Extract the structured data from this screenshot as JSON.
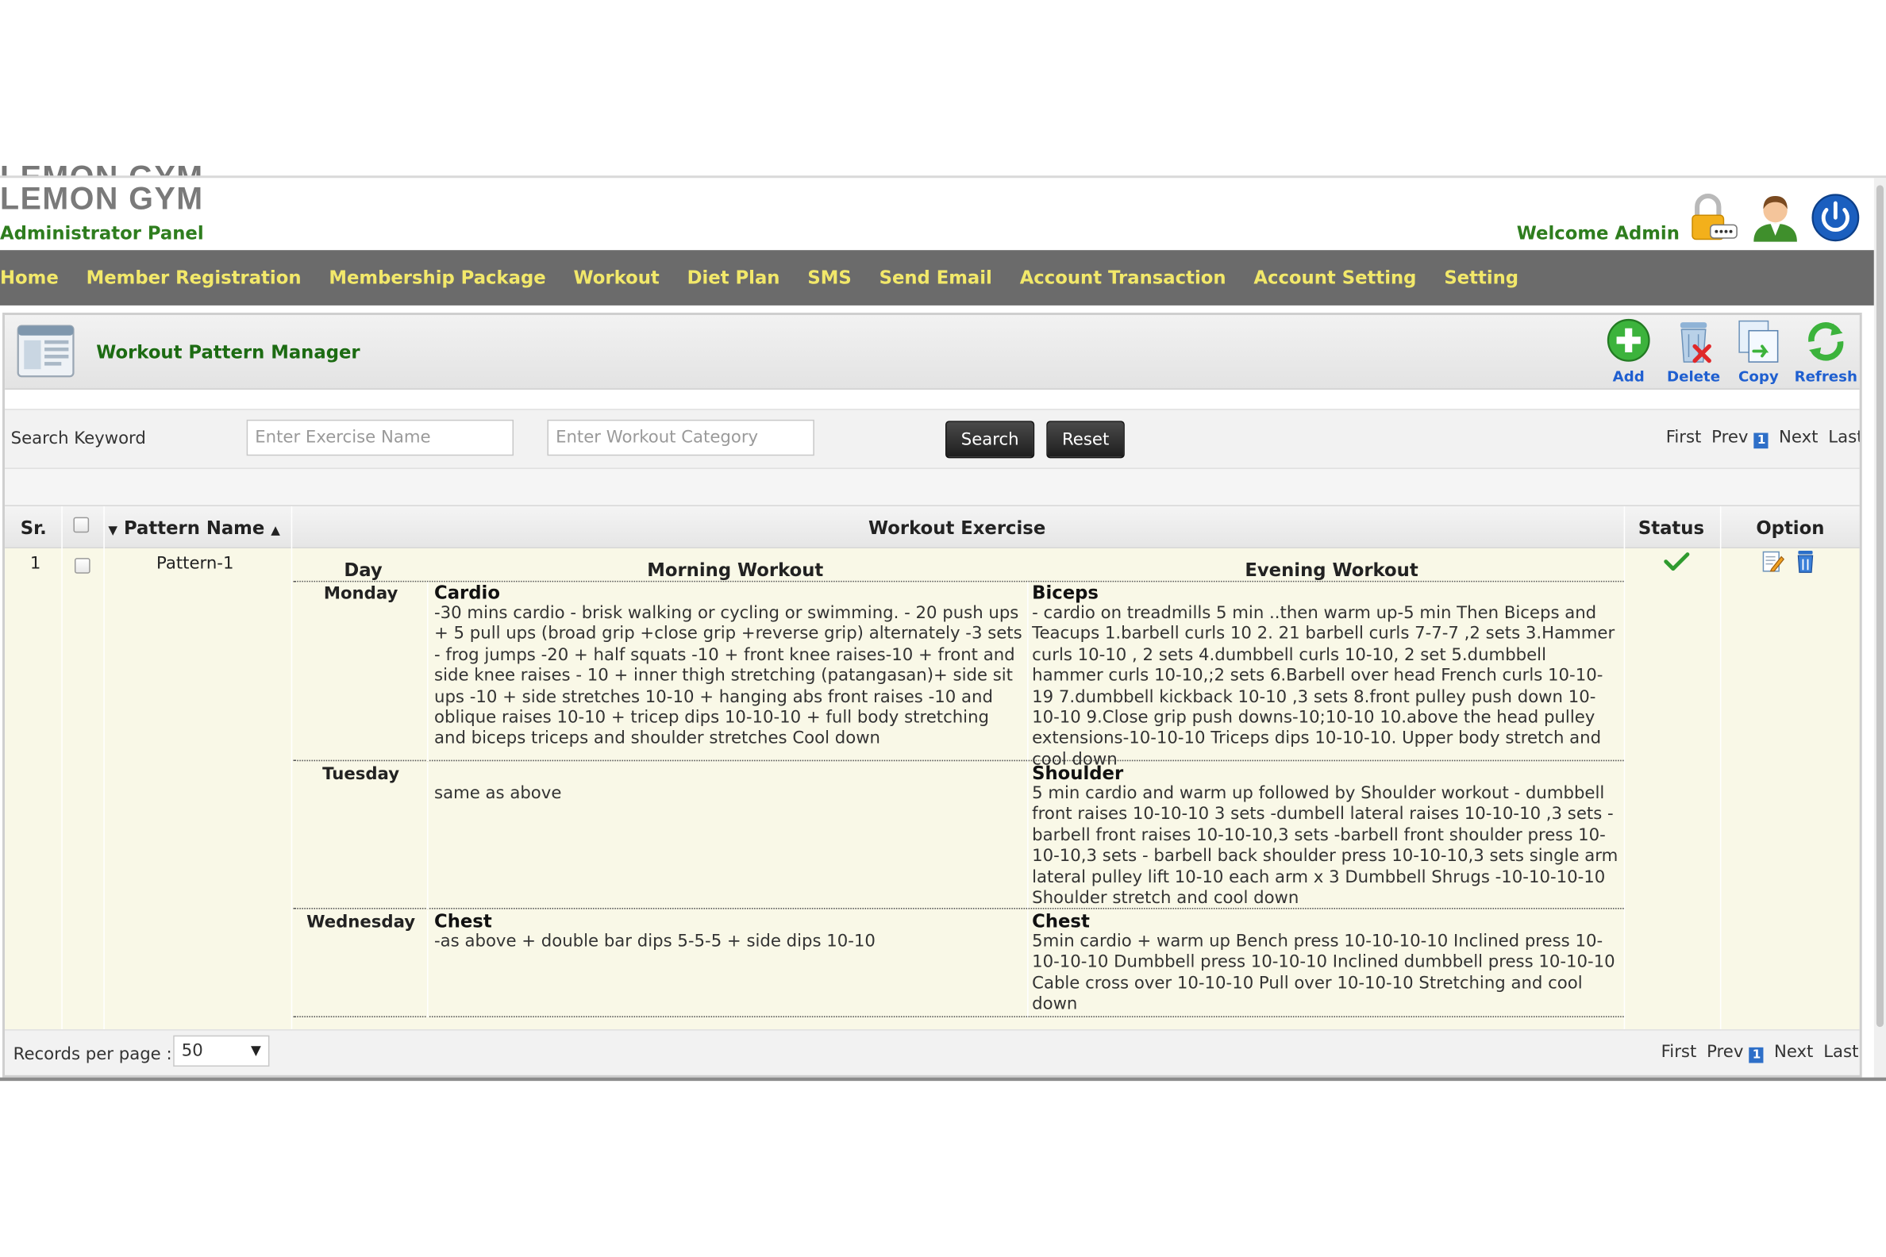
{
  "app": {
    "name": "LEMON GYM",
    "subtitle": "Administrator Panel",
    "welcome": "Welcome Admin",
    "colors": {
      "nav_bg": "#6b6b6b",
      "nav_text": "#f2e86a",
      "brand_green": "#2e7d1e",
      "link_blue": "#1f5fd0",
      "row_bg": "#f9f8e7"
    }
  },
  "header_icons": [
    "lock-icon",
    "admin-user-icon",
    "power-icon"
  ],
  "nav": {
    "items": [
      "Home",
      "Member Registration",
      "Membership Package",
      "Workout",
      "Diet Plan",
      "SMS",
      "Send Email",
      "Account Transaction",
      "Account Setting",
      "Setting"
    ]
  },
  "panel": {
    "title": "Workout Pattern Manager",
    "toolbar": {
      "add": "Add",
      "delete": "Delete",
      "copy": "Copy",
      "refresh": "Refresh"
    }
  },
  "search": {
    "label": "Search Keyword",
    "exercise_placeholder": "Enter Exercise Name",
    "exercise_value": "",
    "category_placeholder": "Enter Workout Category",
    "category_value": "",
    "search_button": "Search",
    "reset_button": "Reset"
  },
  "pager": {
    "first": "First",
    "prev": "Prev",
    "current": "1",
    "next": "Next",
    "last": "Last"
  },
  "table": {
    "headers": {
      "sr": "Sr.",
      "pattern_name": "Pattern Name",
      "workout_exercise": "Workout Exercise",
      "status": "Status",
      "option": "Option"
    },
    "sub_headers": {
      "day": "Day",
      "morning": "Morning Workout",
      "evening": "Evening Workout"
    },
    "rows": [
      {
        "sr": "1",
        "pattern_name": "Pattern-1",
        "status_icon": "check-icon",
        "days": [
          {
            "day": "Monday",
            "morning_title": "Cardio",
            "morning_text": "-30 mins cardio - brisk walking or cycling or swimming. - 20 push ups + 5 pull ups (broad grip +close grip +reverse grip) alternately -3 sets - frog jumps -20 + half squats -10 + front knee raises-10 + front and side knee raises - 10 + inner thigh stretching (patangasan)+ side sit ups -10 + side stretches 10-10 + hanging abs front raises -10 and oblique raises 10-10 + tricep dips 10-10-10 + full body stretching and biceps triceps and shoulder stretches Cool down",
            "evening_title": "Biceps",
            "evening_text": "- cardio on treadmills 5 min ..then warm up-5 min Then Biceps and Teacups 1.barbell curls 10 2. 21 barbell curls 7-7-7 ,2 sets 3.Hammer curls 10-10 , 2 sets 4.dumbbell curls 10-10, 2 set 5.dumbbell hammer curls 10-10,;2 sets 6.Barbell over head French curls 10-10-19 7.dumbbell kickback 10-10 ,3 sets 8.front pulley push down 10-10-10 9.Close grip push downs-10;10-10 10.above the head pulley extensions-10-10-10 Triceps dips 10-10-10. Upper body stretch and cool down"
          },
          {
            "day": "Tuesday",
            "morning_title": "",
            "morning_text": "same as above",
            "evening_title": "Shoulder",
            "evening_text": "5 min cardio and warm up followed by Shoulder workout - dumbbell front raises 10-10-10 3 sets -dumbell lateral raises 10-10-10 ,3 sets - barbell front raises 10-10-10,3 sets -barbell front shoulder press 10-10-10,3 sets - barbell back shoulder press 10-10-10,3 sets single arm lateral pulley lift 10-10 each arm x 3 Dumbbell Shrugs -10-10-10-10 Shoulder stretch and cool down"
          },
          {
            "day": "Wednesday",
            "morning_title": "Chest",
            "morning_text": "-as above + double bar dips 5-5-5 + side dips 10-10",
            "evening_title": "Chest",
            "evening_text": "5min cardio + warm up Bench press 10-10-10-10 Inclined press 10-10-10-10 Dumbbell press 10-10-10 Inclined dumbbell press 10-10-10 Cable cross over 10-10-10 Pull over 10-10-10 Stretching and cool down"
          }
        ]
      }
    ]
  },
  "footer": {
    "records_label": "Records per page :",
    "records_value": "50"
  }
}
